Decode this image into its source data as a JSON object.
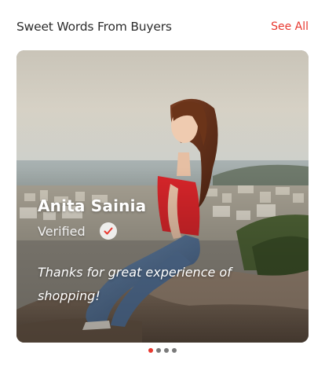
{
  "section": {
    "title": "Sweet Words From Buyers",
    "see_all_label": "See All"
  },
  "testimonial": {
    "reviewer_name": "Anita Sainia",
    "status_label": "Verified",
    "status_icon": "check-circle-icon",
    "review_text": "Thanks for great experience of shopping!"
  },
  "carousel": {
    "total_slides": 4,
    "active_slide": 1
  },
  "colors": {
    "accent": "#e8382f",
    "title_text": "#2c2c2c",
    "dot_inactive": "#7a7a7a"
  }
}
